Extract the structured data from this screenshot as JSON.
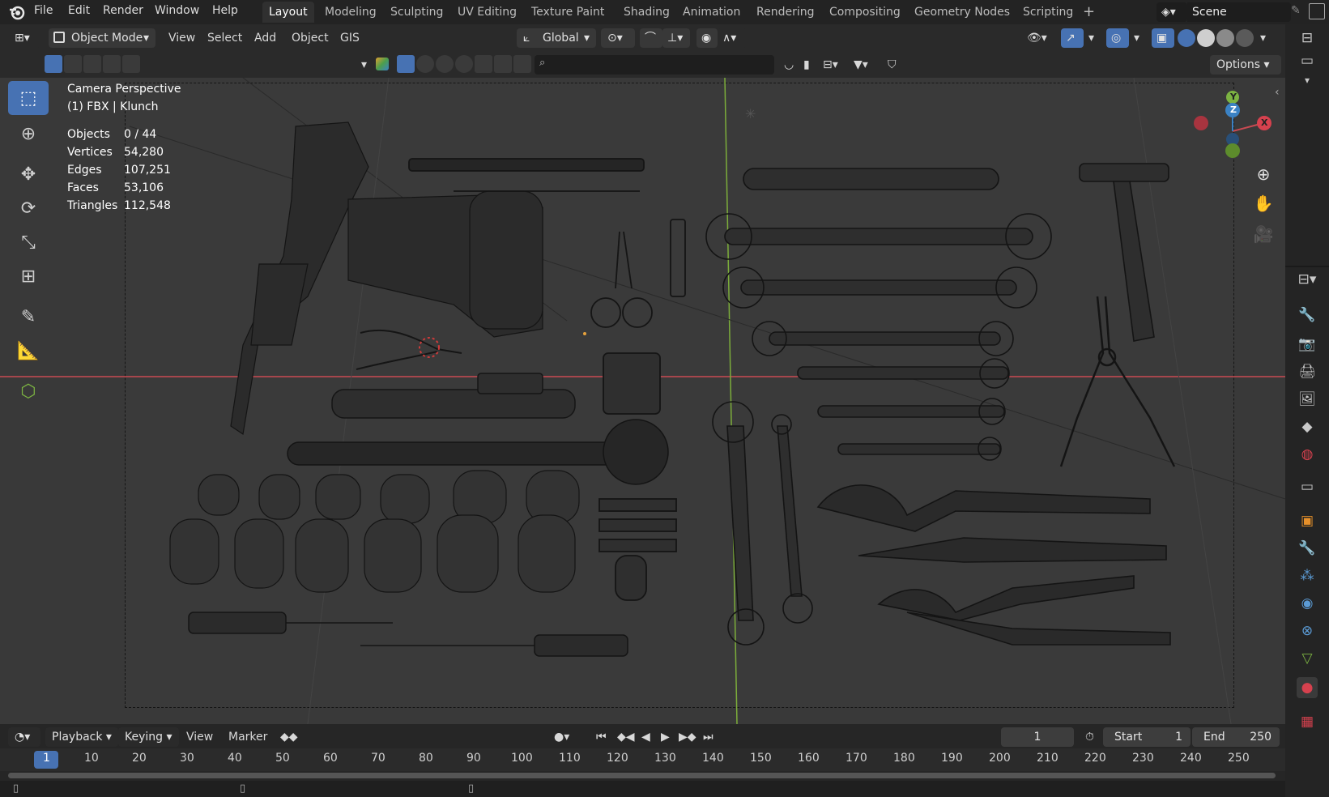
{
  "app": {
    "name": "Blender"
  },
  "menu": [
    "File",
    "Edit",
    "Render",
    "Window",
    "Help"
  ],
  "workspaces": [
    {
      "label": "Layout",
      "active": true
    },
    {
      "label": "Modeling"
    },
    {
      "label": "Sculpting"
    },
    {
      "label": "UV Editing"
    },
    {
      "label": "Texture Paint"
    },
    {
      "label": "Shading"
    },
    {
      "label": "Animation"
    },
    {
      "label": "Rendering"
    },
    {
      "label": "Compositing"
    },
    {
      "label": "Geometry Nodes"
    },
    {
      "label": "Scripting"
    }
  ],
  "scene": {
    "name": "Scene"
  },
  "header": {
    "mode": "Object Mode",
    "view_menu": [
      "View",
      "Select",
      "Add",
      "Object",
      "GIS"
    ],
    "orientation": "Global",
    "options": "Options"
  },
  "overlay": {
    "view_name": "Camera Perspective",
    "collection": "(1) FBX | Klunch",
    "stats_labels": [
      "Objects",
      "Vertices",
      "Edges",
      "Faces",
      "Triangles"
    ],
    "stats_values": [
      "0 / 44",
      "54,280",
      "107,251",
      "53,106",
      "112,548"
    ]
  },
  "gizmo": {
    "x": "X",
    "y": "Y",
    "z": "Z"
  },
  "timeline": {
    "menus": [
      "Playback",
      "Keying",
      "View",
      "Marker"
    ],
    "current_frame": "1",
    "start_label": "Start",
    "start": "1",
    "end_label": "End",
    "end": "250",
    "ruler": [
      "1",
      "10",
      "20",
      "30",
      "40",
      "50",
      "60",
      "70",
      "80",
      "90",
      "100",
      "110",
      "120",
      "130",
      "140",
      "150",
      "160",
      "170",
      "180",
      "190",
      "200",
      "210",
      "220",
      "230",
      "240",
      "250"
    ]
  },
  "colors": {
    "accent": "#4772b3",
    "x_axis": "#d6414e",
    "y_axis": "#7cb342",
    "z_axis": "#3b82c4"
  }
}
